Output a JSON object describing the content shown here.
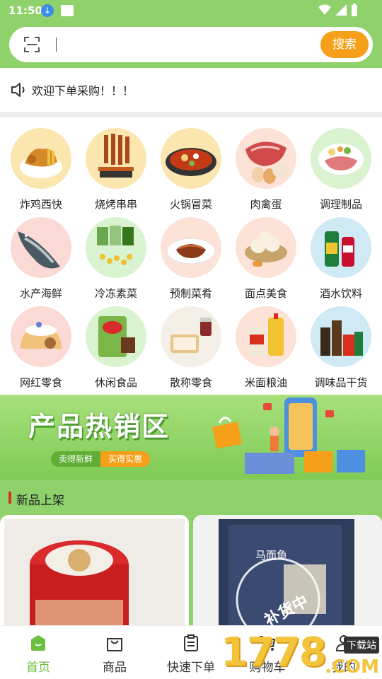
{
  "status_bar": {
    "time": "11:50"
  },
  "search": {
    "button_label": "搜索"
  },
  "notice": {
    "text": "欢迎下单采购！！！"
  },
  "categories": [
    {
      "label": "炸鸡西快",
      "icon": "fried-chicken"
    },
    {
      "label": "烧烤串串",
      "icon": "bbq-skewers"
    },
    {
      "label": "火锅冒菜",
      "icon": "hotpot"
    },
    {
      "label": "肉禽蛋",
      "icon": "meat-eggs"
    },
    {
      "label": "调理制品",
      "icon": "prepared-meat"
    },
    {
      "label": "水产海鲜",
      "icon": "fish"
    },
    {
      "label": "冷冻素菜",
      "icon": "frozen-veg"
    },
    {
      "label": "预制菜肴",
      "icon": "prepared-dish"
    },
    {
      "label": "面点美食",
      "icon": "buns"
    },
    {
      "label": "酒水饮料",
      "icon": "drinks"
    },
    {
      "label": "网红零食",
      "icon": "cake"
    },
    {
      "label": "休闲食品",
      "icon": "chips"
    },
    {
      "label": "散称零食",
      "icon": "toast"
    },
    {
      "label": "米面粮油",
      "icon": "oil-rice"
    },
    {
      "label": "调味品干货",
      "icon": "condiments"
    }
  ],
  "banner": {
    "title": "产品热销区",
    "tag_left": "卖得新鲜",
    "tag_right": "买得实惠"
  },
  "new_arrivals": {
    "heading": "新品上架",
    "card2_text": "马面鱼",
    "card2_stamp": "补货中"
  },
  "tabbar": {
    "items": [
      {
        "label": "首页",
        "icon": "home-icon",
        "active": true
      },
      {
        "label": "商品",
        "icon": "bag-icon",
        "active": false
      },
      {
        "label": "快速下单",
        "icon": "clipboard-icon",
        "active": false
      },
      {
        "label": "购物车",
        "icon": "cart-icon",
        "active": false
      },
      {
        "label": "我的",
        "icon": "user-icon",
        "active": false
      }
    ]
  },
  "watermark": {
    "digits": "1778",
    "site": "下载站",
    "com": ".COM"
  },
  "colors": {
    "brand_green": "#8fd16a",
    "accent_orange": "#f6a01a",
    "active_tab": "#6cbf3f"
  }
}
